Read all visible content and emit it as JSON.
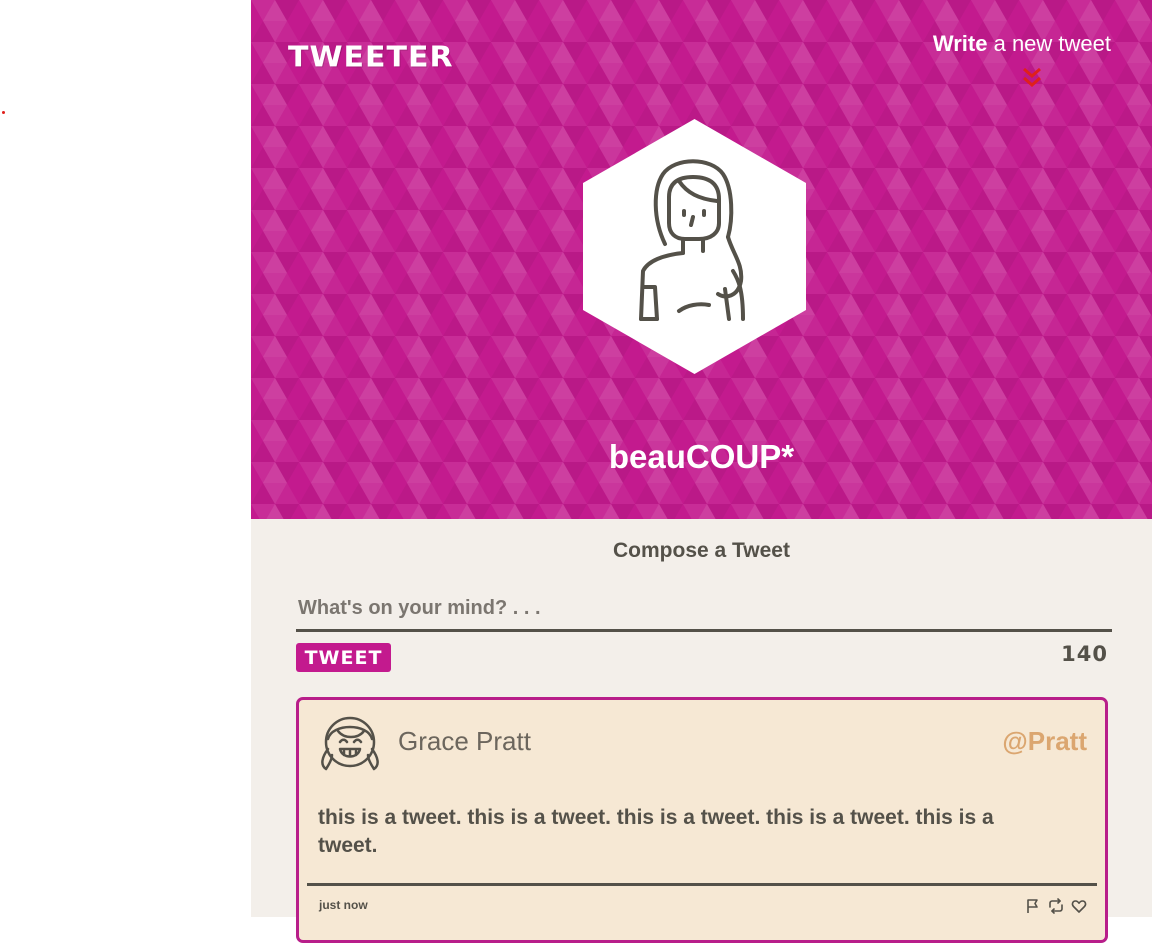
{
  "header": {
    "brand": "TWEETER",
    "write_link": {
      "bold": "Write",
      "rest": " a new tweet"
    },
    "write_icon": "double-chevron-down-icon",
    "avatar_icon": "woman-outline-icon",
    "profile_name": "beauCOUP*",
    "accent_color": "#c31a8e"
  },
  "compose": {
    "title": "Compose a Tweet",
    "placeholder": "What's on your mind? . . .",
    "value": "",
    "tweet_button": "TWEET",
    "counter": "140"
  },
  "tweets": [
    {
      "avatar_icon": "girl-smiling-outline-icon",
      "author": "Grace Pratt",
      "handle": "@Pratt",
      "body": "this is a tweet. this is a tweet. this is a tweet. this is a tweet. this is a tweet.",
      "time": "just now",
      "actions": [
        "flag-icon",
        "retweet-icon",
        "heart-icon"
      ]
    }
  ]
}
